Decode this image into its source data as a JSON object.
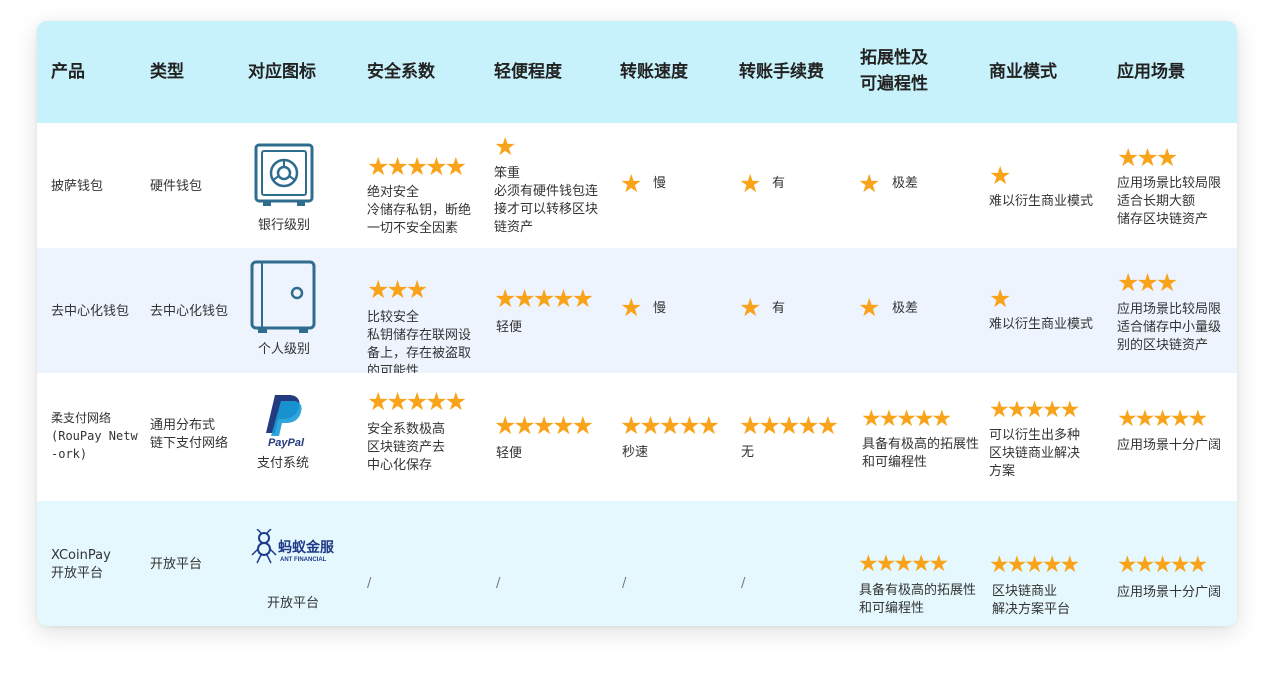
{
  "headers": [
    "产品",
    "类型",
    "对应图标",
    "安全系数",
    "轻便程度",
    "转账速度",
    "转账手续费",
    "拓展性及\n可遍程性",
    "商业模式",
    "应用场景"
  ],
  "rows": [
    {
      "product": "披萨钱包",
      "type": "硬件钱包",
      "icon_label": "银行级别",
      "icon_name": "safe-dial-icon",
      "security_stars": "★★★★★",
      "security_text": "绝对安全\n冷储存私钥，断绝\n一切不安全因素",
      "portability_stars": "★",
      "portability_text": "笨重\n必须有硬件钱包连\n接才可以转移区块\n链资产",
      "speed_stars": "★",
      "speed_text": "慢",
      "fee_stars": "★",
      "fee_text": "有",
      "ext_stars": "★",
      "ext_text": "极差",
      "biz_stars": "★",
      "biz_text": "难以衍生商业模式",
      "scene_stars": "★★★",
      "scene_text": "应用场景比较局限\n适合长期大额\n储存区块链资产"
    },
    {
      "product": "去中心化钱包",
      "type": "去中心化钱包",
      "icon_label": "个人级别",
      "icon_name": "safe-box-icon",
      "security_stars": "★★★",
      "security_text": "比较安全\n私钥储存在联网设\n备上，存在被盗取\n的可能性",
      "portability_stars": "★★★★★",
      "portability_text": "轻便",
      "speed_stars": "★",
      "speed_text": "慢",
      "fee_stars": "★",
      "fee_text": "有",
      "ext_stars": "★",
      "ext_text": "极差",
      "biz_stars": "★",
      "biz_text": "难以衍生商业模式",
      "scene_stars": "★★★",
      "scene_text": "应用场景比较局限\n适合储存中小量级\n别的区块链资产"
    },
    {
      "product": "柔支付网络\n(RouPay Netw\n-ork)",
      "type": "通用分布式\n链下支付网络",
      "icon_label": "支付系统",
      "icon_name": "paypal-logo-icon",
      "icon_text": "PayPal",
      "security_stars": "★★★★★",
      "security_text": "安全系数极高\n区块链资产去\n中心化保存",
      "portability_stars": "★★★★★",
      "portability_text": "轻便",
      "speed_stars": "★★★★★",
      "speed_text": "秒速",
      "fee_stars": "★★★★★",
      "fee_text": "无",
      "ext_stars": "★★★★★",
      "ext_text": "具备有极高的拓展性\n和可编程性",
      "biz_stars": "★★★★★",
      "biz_text": "可以衍生出多种\n区块链商业解决\n方案",
      "scene_stars": "★★★★★",
      "scene_text": "应用场景十分广阔"
    },
    {
      "product": "XCoinPay\n开放平台",
      "type": "开放平台",
      "icon_label": "开放平台",
      "icon_name": "ant-financial-logo-icon",
      "icon_text": "蚂蚁金服",
      "icon_subtext": "ANT FINANCIAL",
      "security_text": "/",
      "portability_text": "/",
      "speed_text": "/",
      "fee_text": "/",
      "ext_stars": "★★★★★",
      "ext_text": "具备有极高的拓展性\n和可编程性",
      "biz_stars": "★★★★★",
      "biz_text": "区块链商业\n解决方案平台",
      "scene_stars": "★★★★★",
      "scene_text": "应用场景十分广阔"
    }
  ],
  "colors": {
    "header_bg": "#c8f2fb",
    "star": "#f8a31a",
    "icon_blue": "#2e6d8e",
    "paypal_dark": "#253b80",
    "paypal_light": "#179bd7",
    "ant_blue": "#1f3b8a"
  }
}
